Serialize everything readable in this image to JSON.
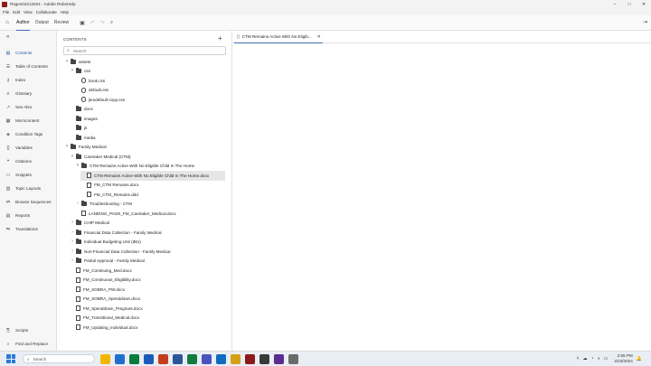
{
  "window": {
    "title": "Rsgen02212024 - Adobe RoboHelp",
    "controls": [
      "–",
      "□",
      "✕"
    ]
  },
  "menu": [
    "File",
    "Edit",
    "View",
    "Collaborate",
    "Help"
  ],
  "ribbon_tabs": [
    "Author",
    "Output",
    "Review"
  ],
  "left_nav": {
    "items": [
      {
        "label": "Contents",
        "icon": "book-icon",
        "active": true
      },
      {
        "label": "Table of Contents",
        "icon": "toc-icon"
      },
      {
        "label": "Index",
        "icon": "key-icon"
      },
      {
        "label": "Glossary",
        "icon": "list-icon"
      },
      {
        "label": "See Also",
        "icon": "arrow-icon"
      },
      {
        "label": "Microcontent",
        "icon": "grid-icon"
      },
      {
        "label": "Condition Tags",
        "icon": "tag-icon"
      },
      {
        "label": "Variables",
        "icon": "braces-icon"
      },
      {
        "label": "Citations",
        "icon": "quote-icon"
      },
      {
        "label": "Snippets",
        "icon": "snippet-icon"
      },
      {
        "label": "Topic Layouts",
        "icon": "layout-icon"
      },
      {
        "label": "Browse Sequences",
        "icon": "sequence-icon"
      },
      {
        "label": "Reports",
        "icon": "report-icon"
      },
      {
        "label": "Translations",
        "icon": "translate-icon"
      }
    ],
    "bottom_items": [
      {
        "label": "Scripts",
        "icon": "script-icon"
      },
      {
        "label": "Find and Replace",
        "icon": "find-icon"
      }
    ]
  },
  "contents": {
    "header": "CONTENTS",
    "search_placeholder": "Search",
    "tree": [
      {
        "label": "assets",
        "depth": 0,
        "type": "folder",
        "chevron": "˅"
      },
      {
        "label": "css",
        "depth": 1,
        "type": "folder",
        "chevron": "˅"
      },
      {
        "label": "book.css",
        "depth": 2,
        "type": "css"
      },
      {
        "label": "default.css",
        "depth": 2,
        "type": "css"
      },
      {
        "label": "jlendefault-copy.css",
        "depth": 2,
        "type": "css"
      },
      {
        "label": "docs",
        "depth": 1,
        "type": "folder"
      },
      {
        "label": "images",
        "depth": 1,
        "type": "folder"
      },
      {
        "label": "js",
        "depth": 1,
        "type": "folder"
      },
      {
        "label": "media",
        "depth": 1,
        "type": "folder"
      },
      {
        "label": "Family Medical",
        "depth": 0,
        "type": "folder",
        "chevron": "˅"
      },
      {
        "label": "Caretaker Medical (CTM)",
        "depth": 1,
        "type": "folder",
        "chevron": "˅"
      },
      {
        "label": "CTM Remains Active With No Eligible Child In The Home",
        "depth": 2,
        "type": "folder",
        "chevron": "˅"
      },
      {
        "label": "CTM Remains Active With No Eligible Child In The Home.docx",
        "depth": 3,
        "type": "doc",
        "selected": true
      },
      {
        "label": "FM_CTM Remains.docx",
        "depth": 3,
        "type": "doc"
      },
      {
        "label": "FM_CTM_Remains.ddd",
        "depth": 3,
        "type": "doc"
      },
      {
        "label": "Troubleshooting - CTM",
        "depth": 2,
        "type": "folder",
        "chevron": "›"
      },
      {
        "label": "LANDING_PAGE_FM_Caretaker_Medical.docx",
        "depth": 2,
        "type": "doc"
      },
      {
        "label": "CHIP Medical",
        "depth": 1,
        "type": "folder",
        "chevron": "›"
      },
      {
        "label": "Financial Data Collection - Family Medical",
        "depth": 1,
        "type": "folder",
        "chevron": "›"
      },
      {
        "label": "Individual Budgeting Unit (IBU)",
        "depth": 1,
        "type": "folder",
        "chevron": "›"
      },
      {
        "label": "Non-Financial Data Collection - Family Medical",
        "depth": 1,
        "type": "folder",
        "chevron": "›"
      },
      {
        "label": "Partial Approval - Family Medical",
        "depth": 1,
        "type": "folder",
        "chevron": "›"
      },
      {
        "label": "FM_Continuing_Med.docx",
        "depth": 1,
        "type": "doc"
      },
      {
        "label": "FM_Continuous_Eligibility.docx",
        "depth": 1,
        "type": "doc"
      },
      {
        "label": "FM_SOBRA_PW.docx",
        "depth": 1,
        "type": "doc"
      },
      {
        "label": "FM_SOBRA_Spenddown.docx",
        "depth": 1,
        "type": "doc"
      },
      {
        "label": "FM_Spenddown_Pregnant.docx",
        "depth": 1,
        "type": "doc"
      },
      {
        "label": "FM_Transitional_Medical.docx",
        "depth": 1,
        "type": "doc"
      },
      {
        "label": "FM_Updating_Individual.docx",
        "depth": 1,
        "type": "doc"
      }
    ]
  },
  "editor": {
    "open_tab": "CTM Remains Active With No Eligib..."
  },
  "taskbar": {
    "search_placeholder": "Search",
    "apps": [
      "#f3b600",
      "#1f6fd1",
      "#0a7c3e",
      "#1e5bb8",
      "#c43e1c",
      "#2b579a",
      "#107c41",
      "#4b53bc",
      "#0f6cbd",
      "#d4a017",
      "#8b1a1a",
      "#3a3a3a",
      "#5b2d8e",
      "#6b6b6b"
    ],
    "time": "2:55 PM",
    "date": "2/23/2024"
  }
}
